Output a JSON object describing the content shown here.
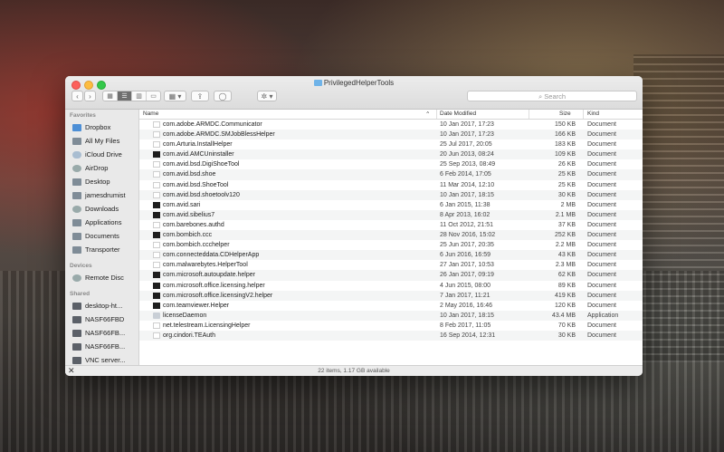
{
  "window": {
    "title": "PrivilegedHelperTools",
    "status": "22 items, 1.17 GB available"
  },
  "toolbar": {
    "back": "‹",
    "forward": "›",
    "views": [
      "▦",
      "☰",
      "▥",
      "▭"
    ],
    "arrange": "▦ ▾",
    "share": "⇪",
    "tags": "◯",
    "action": "✲ ▾",
    "search_placeholder": "Search"
  },
  "sidebar": {
    "sections": [
      {
        "title": "Favorites",
        "items": [
          {
            "label": "Dropbox",
            "icon": "dropbox-icon"
          },
          {
            "label": "All My Files",
            "icon": "all-files-icon"
          },
          {
            "label": "iCloud Drive",
            "icon": "icloud-icon"
          },
          {
            "label": "AirDrop",
            "icon": "airdrop-icon"
          },
          {
            "label": "Desktop",
            "icon": "desktop-icon"
          },
          {
            "label": "jamesdrumist",
            "icon": "home-icon"
          },
          {
            "label": "Downloads",
            "icon": "downloads-icon"
          },
          {
            "label": "Applications",
            "icon": "applications-icon"
          },
          {
            "label": "Documents",
            "icon": "documents-icon"
          },
          {
            "label": "Transporter",
            "icon": "folder-icon"
          }
        ]
      },
      {
        "title": "Devices",
        "items": [
          {
            "label": "Remote Disc",
            "icon": "disc-icon"
          }
        ]
      },
      {
        "title": "Shared",
        "items": [
          {
            "label": "desktop-ht...",
            "icon": "computer-icon"
          },
          {
            "label": "NASF66FBD",
            "icon": "computer-icon"
          },
          {
            "label": "NASF66FB...",
            "icon": "computer-icon"
          },
          {
            "label": "NASF66FB...",
            "icon": "computer-icon"
          },
          {
            "label": "VNC server...",
            "icon": "computer-icon"
          }
        ]
      }
    ]
  },
  "columns": {
    "name": "Name",
    "date": "Date Modified",
    "size": "Size",
    "kind": "Kind"
  },
  "files": [
    {
      "name": "com.adobe.ARMDC.Communicator",
      "date": "10 Jan 2017, 17:23",
      "size": "150 KB",
      "kind": "Document",
      "type": "doc"
    },
    {
      "name": "com.adobe.ARMDC.SMJobBlessHelper",
      "date": "10 Jan 2017, 17:23",
      "size": "166 KB",
      "kind": "Document",
      "type": "doc"
    },
    {
      "name": "com.Arturia.InstallHelper",
      "date": "25 Jul 2017, 20:05",
      "size": "183 KB",
      "kind": "Document",
      "type": "doc"
    },
    {
      "name": "com.avid.AMCUninstaller",
      "date": "20 Jun 2013, 08:24",
      "size": "109 KB",
      "kind": "Document",
      "type": "exec"
    },
    {
      "name": "com.avid.bsd.DigiShoeTool",
      "date": "25 Sep 2013, 08:49",
      "size": "26 KB",
      "kind": "Document",
      "type": "doc"
    },
    {
      "name": "com.avid.bsd.shoe",
      "date": "6 Feb 2014, 17:05",
      "size": "25 KB",
      "kind": "Document",
      "type": "doc"
    },
    {
      "name": "com.avid.bsd.ShoeTool",
      "date": "11 Mar 2014, 12:10",
      "size": "25 KB",
      "kind": "Document",
      "type": "doc"
    },
    {
      "name": "com.avid.bsd.shoetoolv120",
      "date": "10 Jan 2017, 18:15",
      "size": "30 KB",
      "kind": "Document",
      "type": "doc"
    },
    {
      "name": "com.avid.sari",
      "date": "6 Jan 2015, 11:38",
      "size": "2 MB",
      "kind": "Document",
      "type": "exec"
    },
    {
      "name": "com.avid.sibelius7",
      "date": "8 Apr 2013, 16:02",
      "size": "2.1 MB",
      "kind": "Document",
      "type": "exec"
    },
    {
      "name": "com.barebones.authd",
      "date": "11 Oct 2012, 21:51",
      "size": "37 KB",
      "kind": "Document",
      "type": "doc"
    },
    {
      "name": "com.bombich.ccc",
      "date": "28 Nov 2016, 15:02",
      "size": "252 KB",
      "kind": "Document",
      "type": "exec"
    },
    {
      "name": "com.bombich.ccchelper",
      "date": "25 Jun 2017, 20:35",
      "size": "2.2 MB",
      "kind": "Document",
      "type": "doc"
    },
    {
      "name": "com.connecteddata.CDHelperApp",
      "date": "6 Jun 2016, 16:59",
      "size": "43 KB",
      "kind": "Document",
      "type": "doc"
    },
    {
      "name": "com.malwarebytes.HelperTool",
      "date": "27 Jan 2017, 10:53",
      "size": "2.3 MB",
      "kind": "Document",
      "type": "doc"
    },
    {
      "name": "com.microsoft.autoupdate.helper",
      "date": "26 Jan 2017, 09:19",
      "size": "62 KB",
      "kind": "Document",
      "type": "exec"
    },
    {
      "name": "com.microsoft.office.licensing.helper",
      "date": "4 Jun 2015, 08:00",
      "size": "89 KB",
      "kind": "Document",
      "type": "exec"
    },
    {
      "name": "com.microsoft.office.licensingV2.helper",
      "date": "7 Jan 2017, 11:21",
      "size": "419 KB",
      "kind": "Document",
      "type": "exec"
    },
    {
      "name": "com.teamviewer.Helper",
      "date": "2 May 2016, 16:46",
      "size": "120 KB",
      "kind": "Document",
      "type": "exec"
    },
    {
      "name": "licenseDaemon",
      "date": "10 Jan 2017, 18:15",
      "size": "43.4 MB",
      "kind": "Application",
      "type": "app"
    },
    {
      "name": "net.telestream.LicensingHelper",
      "date": "8 Feb 2017, 11:05",
      "size": "70 KB",
      "kind": "Document",
      "type": "doc"
    },
    {
      "name": "org.cindori.TEAuth",
      "date": "16 Sep 2014, 12:31",
      "size": "30 KB",
      "kind": "Document",
      "type": "doc"
    }
  ]
}
